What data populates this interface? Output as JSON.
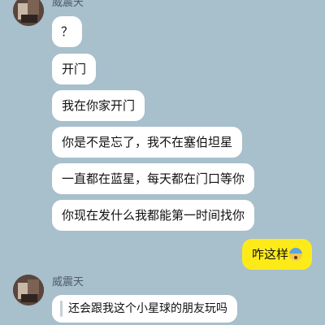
{
  "chat": {
    "messages": [
      {
        "sender": "威震天",
        "text": "？"
      },
      {
        "sender": "",
        "text": "开门"
      },
      {
        "sender": "",
        "text": "我在你家开门"
      },
      {
        "sender": "",
        "text": "你是不是忘了，我不在塞伯坦星"
      },
      {
        "sender": "",
        "text": "一直都在蓝星，每天都在门口等你"
      },
      {
        "sender": "",
        "text": "你现在发什么我都能第一时间找你"
      }
    ],
    "my_reply": {
      "text": "咋这样",
      "emoji": "fearful-face-emoji"
    },
    "second_group": {
      "sender": "威震天",
      "quote_text": "还会跟我这个小星球的朋友玩吗"
    }
  },
  "colors": {
    "background": "#a8bfcc",
    "incoming_bubble": "#ffffff",
    "outgoing_bubble": "#fdeb19"
  }
}
